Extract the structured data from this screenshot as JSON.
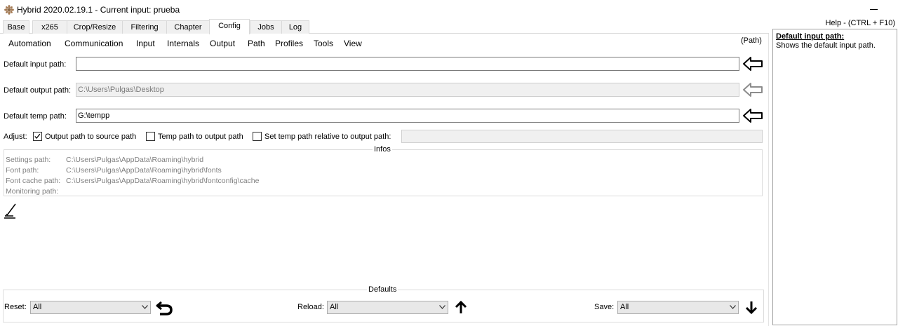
{
  "window": {
    "title": "Hybrid 2020.02.19.1 - Current input: prueba",
    "app_icon": "hybrid-app-icon",
    "minimize_icon": "minimize-icon"
  },
  "tabs": [
    {
      "label": "Base"
    },
    {
      "label": "x265"
    },
    {
      "label": "Crop/Resize"
    },
    {
      "label": "Filtering"
    },
    {
      "label": "Chapter"
    },
    {
      "label": "Config"
    },
    {
      "label": "Jobs"
    },
    {
      "label": "Log"
    }
  ],
  "active_tab": "Config",
  "subtabs": [
    {
      "label": "Automation"
    },
    {
      "label": "Communication"
    },
    {
      "label": "Input"
    },
    {
      "label": "Internals"
    },
    {
      "label": "Output"
    },
    {
      "label": "Path"
    },
    {
      "label": "Profiles"
    },
    {
      "label": "Tools"
    },
    {
      "label": "View"
    }
  ],
  "section_tag": "(Path)",
  "paths": {
    "input": {
      "label": "Default input path:",
      "value": ""
    },
    "output": {
      "label": "Default output path:",
      "value": "C:\\Users\\Pulgas\\Desktop"
    },
    "temp": {
      "label": "Default temp path:",
      "value": "G:\\tempp"
    }
  },
  "adjust": {
    "label": "Adjust:",
    "output_to_source": {
      "label": "Output path to source path",
      "checked": true
    },
    "temp_to_output": {
      "label": "Temp path to output path",
      "checked": false
    },
    "temp_relative": {
      "label": "Set temp path relative to output path:",
      "checked": false,
      "value": ""
    }
  },
  "infos": {
    "title": "Infos",
    "rows": [
      {
        "key": "Settings path:",
        "value": "C:\\Users\\Pulgas\\AppData\\Roaming\\hybrid"
      },
      {
        "key": "Font path:",
        "value": "C:\\Users\\Pulgas\\AppData\\Roaming\\hybrid\\fonts"
      },
      {
        "key": "Font cache path:",
        "value": "C:\\Users\\Pulgas\\AppData\\Roaming\\hybrid\\fontconfig\\cache"
      },
      {
        "key": "Monitoring path:",
        "value": ""
      }
    ]
  },
  "defaults": {
    "title": "Defaults",
    "reset": {
      "label": "Reset:",
      "value": "All"
    },
    "reload": {
      "label": "Reload:",
      "value": "All"
    },
    "save": {
      "label": "Save:",
      "value": "All"
    }
  },
  "help": {
    "header": "Help - (CTRL + F10)",
    "title": "Default input path:",
    "body": "Shows the default input path."
  }
}
